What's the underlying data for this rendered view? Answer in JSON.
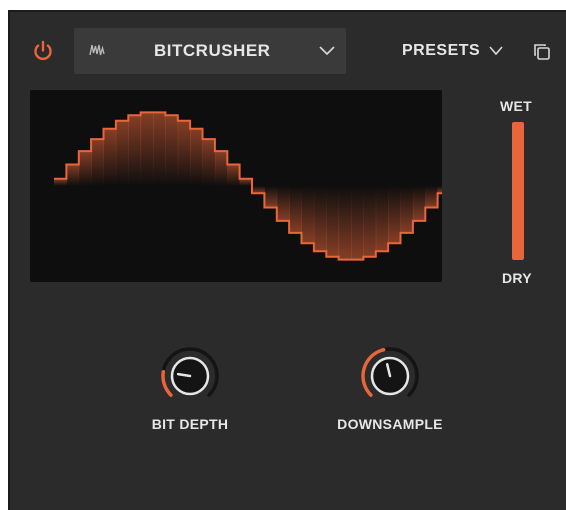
{
  "header": {
    "effect_name": "BITCRUSHER",
    "presets_label": "PRESETS"
  },
  "icons": {
    "power": "power-icon",
    "waveform": "waveform-icon",
    "dropdown": "chevron-down-icon",
    "copy": "copy-icon"
  },
  "mix": {
    "wet_label": "WET",
    "dry_label": "DRY",
    "level": 1.0
  },
  "knobs": [
    {
      "label": "BIT DEPTH",
      "value": 0.2
    },
    {
      "label": "DOWNSAMPLE",
      "value": 0.45
    }
  ],
  "colors": {
    "accent": "#e8663a",
    "panel": "#2b2b2b",
    "display_bg": "#0e0e0e",
    "text": "#e6e6e6"
  },
  "waveform": {
    "shape": "stepped sine",
    "cycles": 1,
    "steps_per_cycle": 32
  }
}
